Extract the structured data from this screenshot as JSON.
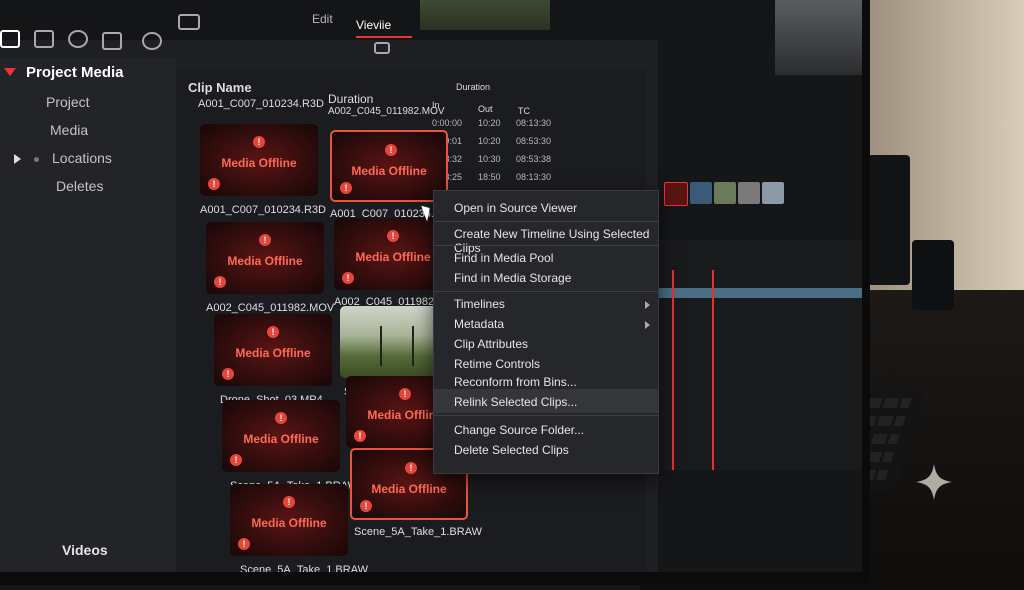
{
  "top_tabs": {
    "edit": "Edit",
    "media": "Vieviie"
  },
  "sidebar": {
    "title": "Project Media",
    "items": [
      "Project",
      "Media",
      "Locations",
      "Deletes"
    ],
    "bottom": "Videos"
  },
  "pool": {
    "headers": {
      "clip_name": "Clip Name",
      "duration": "Duration",
      "duration2": "Duration",
      "in": "In",
      "out": "Out",
      "tc": "TC"
    },
    "top_row": {
      "name": "A001_C007_010234.R3D",
      "duration": "A002_C045_011982.MOV"
    },
    "table_rows": [
      {
        "in": "0:00:00",
        "out": "10:20",
        "tc": "08:13:30"
      },
      {
        "in": "0:49:01",
        "out": "10:20",
        "tc": "08:53:30"
      },
      {
        "in": "0:08:32",
        "out": "10:30",
        "tc": "08:53:38"
      },
      {
        "in": "0:08:25",
        "out": "18:50",
        "tc": "08:13:30"
      },
      {
        "in": "0:08:35",
        "out": "10:20",
        "tc": "08:13:30"
      }
    ],
    "media_offline": "Media Offline",
    "warn_glyph": "!",
    "clips": [
      {
        "label": "A001_C007_010234.R3D",
        "offline": true,
        "selected": false
      },
      {
        "label": "A001_C007_010234.R3D",
        "offline": true,
        "selected": true
      },
      {
        "label": "A002_C045_011982.MOV",
        "offline": true,
        "selected": false
      },
      {
        "label": "A002_C045_011982.MOV",
        "offline": true,
        "selected": false
      },
      {
        "label": "Drone_Shot_03.MP4",
        "offline": true,
        "selected": false
      },
      {
        "label": "Scene_5A_Take_1.BRAW",
        "offline": false,
        "selected": false
      },
      {
        "label": "Scene_5A_Take_1.BRAW",
        "offline": true,
        "selected": false
      },
      {
        "label": "Scene_5A_Take_1.BRAW",
        "offline": true,
        "selected": false
      },
      {
        "label": "Scene_5A_Take_1.BRAW",
        "offline": true,
        "selected": false
      },
      {
        "label": "Scene_5A_Take_1.BRAW",
        "offline": true,
        "selected": true
      }
    ]
  },
  "context_menu": {
    "items": [
      "Open in Source Viewer",
      "Create New Timeline Using Selected Clips",
      "Find in Media Pool",
      "Find in Media Storage",
      "Timelines",
      "Metadata",
      "Clip Attributes",
      "Retime Controls",
      "Reconform from Bins...",
      "Relink Selected Clips...",
      "Change Source Folder...",
      "Delete Selected Clips"
    ]
  },
  "colors": {
    "accent": "#e33333",
    "offline_text": "#ff6a55",
    "selection_border": "#e8553a"
  }
}
